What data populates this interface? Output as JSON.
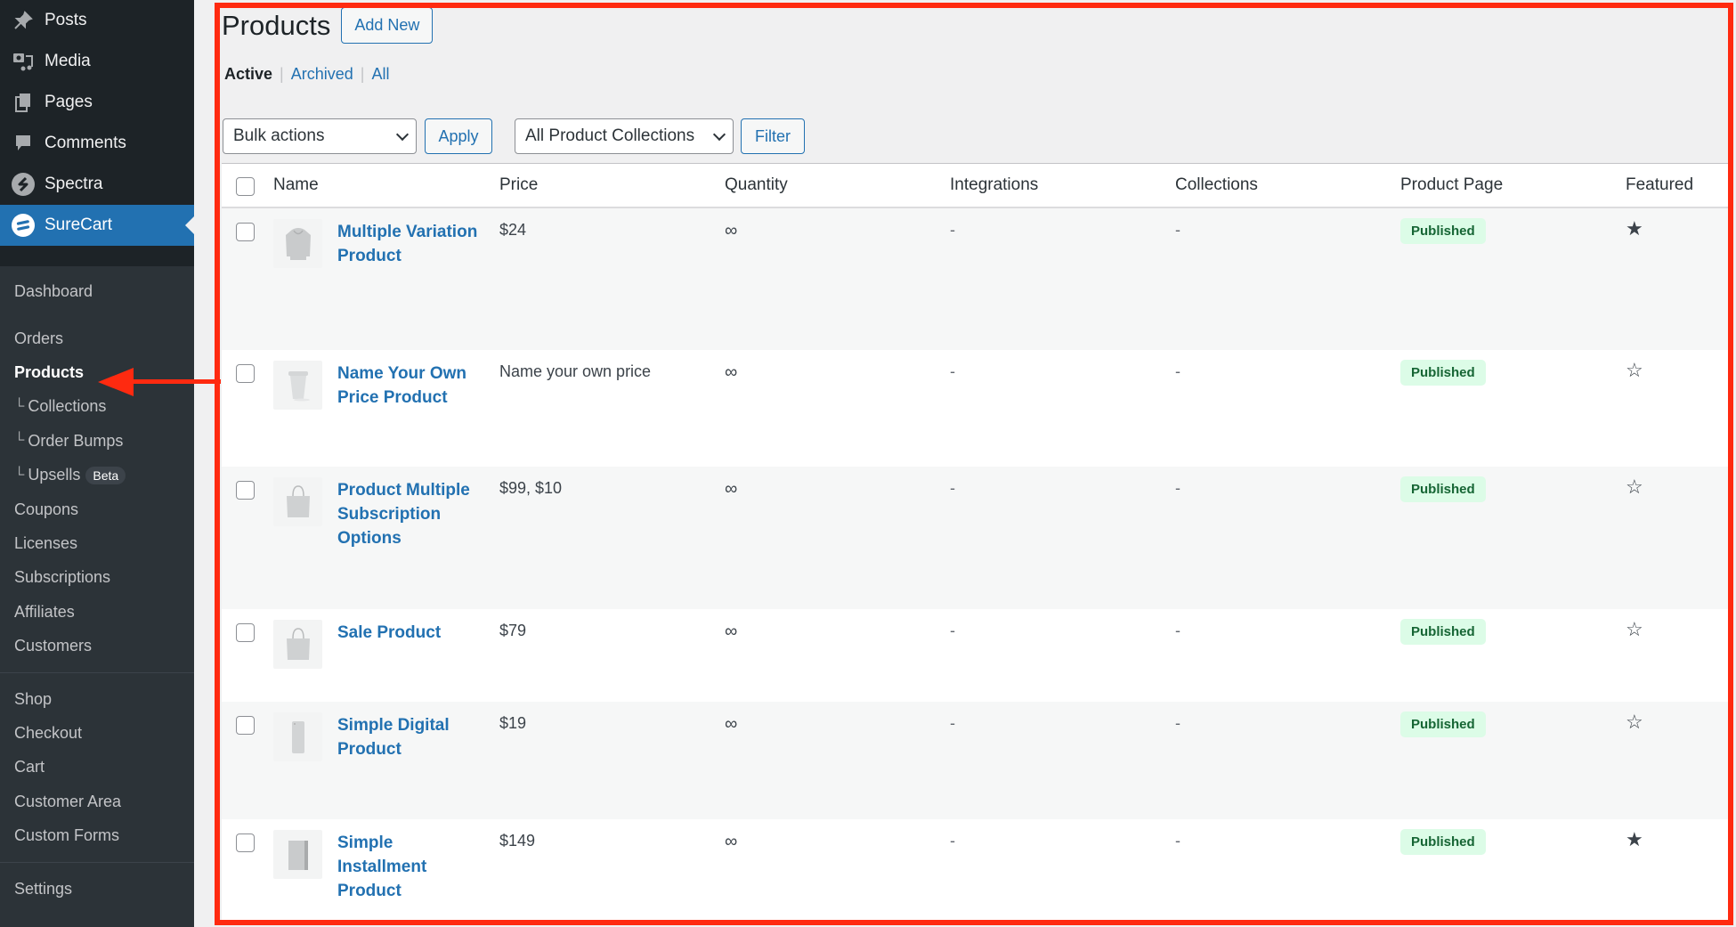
{
  "sidebar": {
    "top_items": [
      {
        "label": "Posts",
        "icon": "pin-icon"
      },
      {
        "label": "Media",
        "icon": "media-icon"
      },
      {
        "label": "Pages",
        "icon": "pages-icon"
      },
      {
        "label": "Comments",
        "icon": "comment-icon"
      },
      {
        "label": "Spectra",
        "icon": "spectra-icon"
      },
      {
        "label": "SureCart",
        "icon": "surecart-icon",
        "active": true
      }
    ],
    "submenu": {
      "dashboard": "Dashboard",
      "group1": [
        {
          "label": "Orders"
        },
        {
          "label": "Products",
          "current": true
        },
        {
          "label": "Collections",
          "child": true
        },
        {
          "label": "Order Bumps",
          "child": true
        },
        {
          "label": "Upsells",
          "child": true,
          "badge": "Beta"
        },
        {
          "label": "Coupons"
        },
        {
          "label": "Licenses"
        },
        {
          "label": "Subscriptions"
        },
        {
          "label": "Affiliates"
        },
        {
          "label": "Customers"
        }
      ],
      "group2": [
        {
          "label": "Shop"
        },
        {
          "label": "Checkout"
        },
        {
          "label": "Cart"
        },
        {
          "label": "Customer Area"
        },
        {
          "label": "Custom Forms"
        }
      ],
      "group3": [
        {
          "label": "Settings"
        }
      ],
      "child_marker": "└"
    }
  },
  "header": {
    "title": "Products",
    "add_new": "Add New"
  },
  "views": {
    "active": "Active",
    "archived": "Archived",
    "all": "All",
    "separator": "|"
  },
  "toolbar": {
    "bulk_actions": "Bulk actions",
    "apply": "Apply",
    "collections_filter": "All Product Collections",
    "filter": "Filter"
  },
  "table": {
    "columns": [
      "Name",
      "Price",
      "Quantity",
      "Integrations",
      "Collections",
      "Product Page",
      "Featured"
    ],
    "rows": [
      {
        "name": "Multiple Variation Product",
        "thumb": "hoodie",
        "price": "$24",
        "quantity": "∞",
        "integrations": "-",
        "collections": "-",
        "page_status": "Published",
        "featured": true
      },
      {
        "name": "Name Your Own Price Product",
        "thumb": "cup",
        "price": "Name your own price",
        "quantity": "∞",
        "integrations": "-",
        "collections": "-",
        "page_status": "Published",
        "featured": false
      },
      {
        "name": "Product Multiple Subscription Options",
        "thumb": "tote",
        "price": "$99, $10",
        "quantity": "∞",
        "integrations": "-",
        "collections": "-",
        "page_status": "Published",
        "featured": false
      },
      {
        "name": "Sale Product",
        "thumb": "tote",
        "price": "$79",
        "quantity": "∞",
        "integrations": "-",
        "collections": "-",
        "page_status": "Published",
        "featured": false
      },
      {
        "name": "Simple Digital Product",
        "thumb": "phone",
        "price": "$19",
        "quantity": "∞",
        "integrations": "-",
        "collections": "-",
        "page_status": "Published",
        "featured": false
      },
      {
        "name": "Simple Installment Product",
        "thumb": "box",
        "price": "$149",
        "quantity": "∞",
        "integrations": "-",
        "collections": "-",
        "page_status": "Published",
        "featured": true
      }
    ]
  },
  "icons": {
    "star_filled": "★",
    "star_empty": "☆"
  },
  "colors": {
    "accent": "#2271b1",
    "sidebar_bg": "#1d2327",
    "submenu_bg": "#2c3338",
    "badge_bg": "#dcfce7",
    "badge_text": "#166534",
    "annotation": "#ff2a10"
  }
}
